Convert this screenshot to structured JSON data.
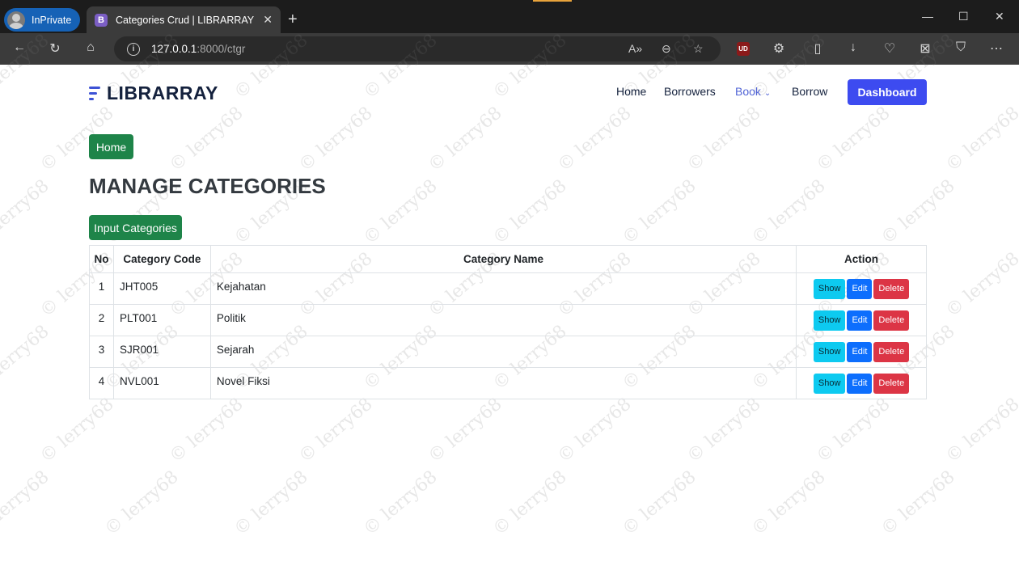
{
  "browser": {
    "inprivate_label": "InPrivate",
    "tab_title": "Categories Crud | LIBRARRAY",
    "tab_favicon": "B",
    "url_host": "127.0.0.1",
    "url_path": ":8000/ctgr"
  },
  "navbar": {
    "brand": "LIBRARRAY",
    "links": [
      "Home",
      "Borrowers",
      "Book",
      "Borrow"
    ],
    "dashboard_label": "Dashboard"
  },
  "main": {
    "home_button": "Home",
    "page_title": "MANAGE CATEGORIES",
    "input_button": "Input Categories",
    "table": {
      "headers": [
        "No",
        "Category Code",
        "Category Name",
        "Action"
      ],
      "rows": [
        {
          "no": "1",
          "code": "JHT005",
          "name": "Kejahatan"
        },
        {
          "no": "2",
          "code": "PLT001",
          "name": "Politik"
        },
        {
          "no": "3",
          "code": "SJR001",
          "name": "Sejarah"
        },
        {
          "no": "4",
          "code": "NVL001",
          "name": "Novel Fiksi"
        }
      ],
      "actions": {
        "show": "Show",
        "edit": "Edit",
        "delete": "Delete"
      }
    }
  },
  "watermark": "© lerry68",
  "colors": {
    "accent_blue": "#3d4bf0",
    "green": "#1e8449",
    "show": "#0dcaf0",
    "edit": "#0d6efd",
    "delete": "#dc3545"
  }
}
